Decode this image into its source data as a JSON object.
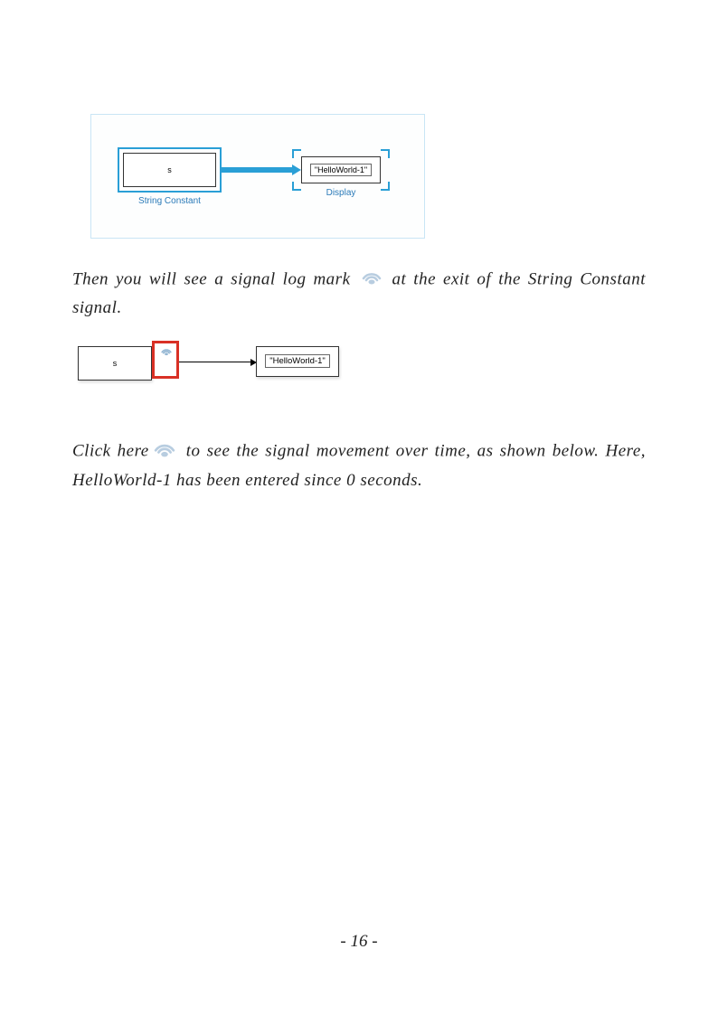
{
  "diagram1": {
    "block1_text": "s",
    "block1_label": "String Constant",
    "block2_text": "\"HelloWorld-1\"",
    "block2_label": "Display"
  },
  "para1": {
    "part1": "Then you will see a signal log mark ",
    "part2": " at the exit of the String Constant signal."
  },
  "diagram2": {
    "block1_text": "s",
    "block2_text": "\"HelloWorld-1\""
  },
  "para2": {
    "part1": "Click here",
    "part2": " to see the signal movement over time, as shown below. Here, HelloWorld-1 has been entered since 0 seconds."
  },
  "page_number": "- 16 -"
}
